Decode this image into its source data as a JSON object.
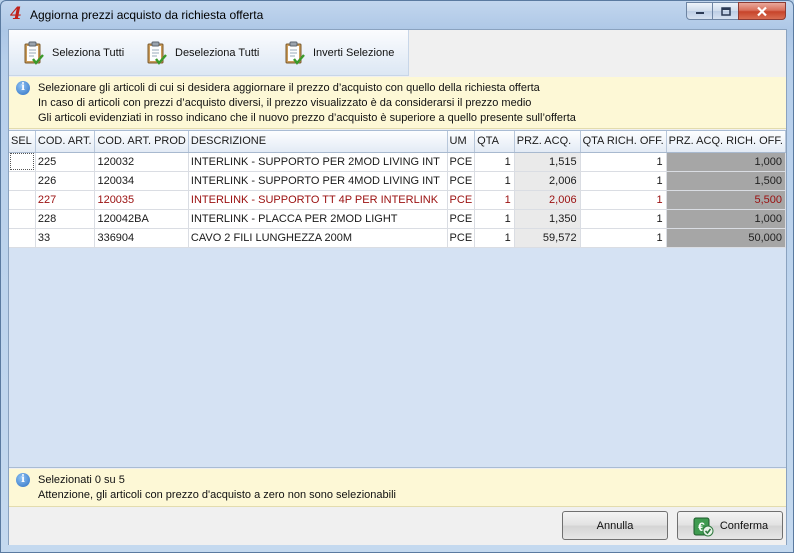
{
  "window": {
    "title": "Aggiorna prezzi acquisto da richiesta offerta",
    "icon": "app-logo-icon"
  },
  "toolbar": {
    "select_all": "Seleziona Tutti",
    "deselect_all": "Deseleziona Tutti",
    "invert": "Inverti Selezione"
  },
  "info": {
    "line1": "Selezionare gli articoli di cui si desidera aggiornare il prezzo d’acquisto con quello della richiesta offerta",
    "line2": "In caso di articoli con prezzi d’acquisto diversi, il prezzo visualizzato è da considerarsi il prezzo medio",
    "line3": "Gli articoli evidenziati in rosso indicano che il nuovo prezzo d’acquisto è superiore a quello presente sull’offerta"
  },
  "grid": {
    "columns": [
      "SEL",
      "COD. ART.",
      "COD. ART. PROD",
      "DESCRIZIONE",
      "UM",
      "QTA",
      "PRZ. ACQ.",
      "QTA RICH. OFF.",
      "PRZ. ACQ. RICH. OFF."
    ],
    "rows": [
      {
        "sel": "",
        "cod": "225",
        "prod": "120032",
        "desc": "INTERLINK - SUPPORTO PER 2MOD LIVING INT",
        "um": "PCE",
        "qta": "1",
        "prz": "1,515",
        "qta_off": "1",
        "prz_off": "1,000"
      },
      {
        "sel": "",
        "cod": "226",
        "prod": "120034",
        "desc": "INTERLINK - SUPPORTO PER 4MOD LIVING INT",
        "um": "PCE",
        "qta": "1",
        "prz": "2,006",
        "qta_off": "1",
        "prz_off": "1,500"
      },
      {
        "sel": "",
        "cod": "227",
        "prod": "120035",
        "desc": "INTERLINK - SUPPORTO TT 4P PER INTERLINK",
        "um": "PCE",
        "qta": "1",
        "prz": "2,006",
        "qta_off": "1",
        "prz_off": "5,500"
      },
      {
        "sel": "",
        "cod": "228",
        "prod": "120042BA",
        "desc": "INTERLINK - PLACCA PER 2MOD LIGHT",
        "um": "PCE",
        "qta": "1",
        "prz": "1,350",
        "qta_off": "1",
        "prz_off": "1,000"
      },
      {
        "sel": "",
        "cod": "33",
        "prod": "336904",
        "desc": "CAVO 2 FILI LUNGHEZZA 200M",
        "um": "PCE",
        "qta": "1",
        "prz": "59,572",
        "qta_off": "1",
        "prz_off": "50,000"
      }
    ]
  },
  "status": {
    "line1": "Selezionati 0 su 5",
    "line2": "Attenzione, gli articoli con prezzo d'acquisto a zero non sono selezionabili"
  },
  "buttons": {
    "cancel": "Annulla",
    "confirm": "Conferma"
  }
}
